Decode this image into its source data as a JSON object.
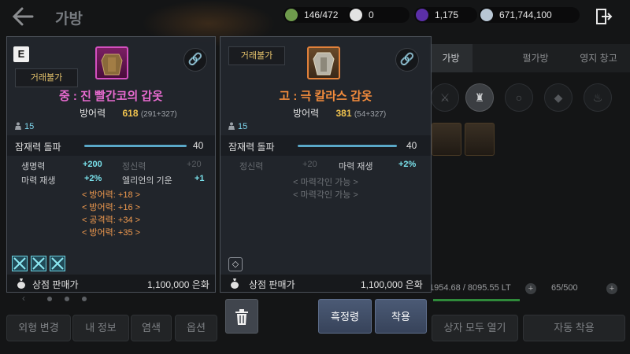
{
  "header": {
    "title": "가방",
    "currencies": [
      {
        "icon": "stamina-icon",
        "value": "146/472",
        "color": "#8fbf6a"
      },
      {
        "icon": "pearl-icon",
        "value": "0",
        "color": "#e8e8e8"
      },
      {
        "icon": "black-gem-icon",
        "value": "1,175",
        "color": "#6a3db8"
      },
      {
        "icon": "silver-icon",
        "value": "671,744,100",
        "color": "#c8d4e0"
      }
    ]
  },
  "background": {
    "tabs": [
      "가방",
      "펄가방",
      "영지 창고"
    ],
    "weight": "1954.68 / 8095.55 LT",
    "inventory_count": "65/500",
    "bottom_buttons": [
      "외형 변경",
      "내 정보",
      "염색",
      "옵션",
      "상자 모두 열기",
      "자동 착용"
    ]
  },
  "left_item": {
    "grade_badge": "E",
    "trade_tag": "거래불가",
    "name": "중 : 진 빨간코의 갑옷",
    "name_color": "#e86bd0",
    "defense_label": "방어력",
    "defense_value": "618",
    "defense_breakdown": "(291+327)",
    "grade_number": "15",
    "potential_label": "잠재력 돌파",
    "potential_value": "40",
    "stats": [
      {
        "label": "생명력",
        "value": "+200",
        "label2": "정신력",
        "value2": "+20"
      },
      {
        "label": "마력 재생",
        "value": "+2%",
        "label2": "엘리언의 기운",
        "value2": "+1"
      }
    ],
    "bonuses": [
      "< 방어력: +18 >",
      "< 방어력: +16 >",
      "< 공격력: +34 >",
      "< 방어력: +35 >"
    ],
    "sell_label": "상점 판매가",
    "sell_value": "1,100,000 은화"
  },
  "right_item": {
    "trade_tag": "거래불가",
    "name": "고 : 극 칼라스 갑옷",
    "name_color": "#f28b3c",
    "defense_label": "방어력",
    "defense_value": "381",
    "defense_breakdown": "(54+327)",
    "grade_number": "15",
    "potential_label": "잠재력 돌파",
    "potential_value": "40",
    "stats": [
      {
        "label": "정신력",
        "value": "+20",
        "label2": "마력 재생",
        "value2": "+2%"
      }
    ],
    "bonuses": [
      "< 마력각인 가능 >",
      "< 마력각인 가능 >"
    ],
    "sell_label": "상점 판매가",
    "sell_value": "1,100,000 은화"
  },
  "actions": {
    "seal_label": "흑정령",
    "equip_label": "착용"
  }
}
